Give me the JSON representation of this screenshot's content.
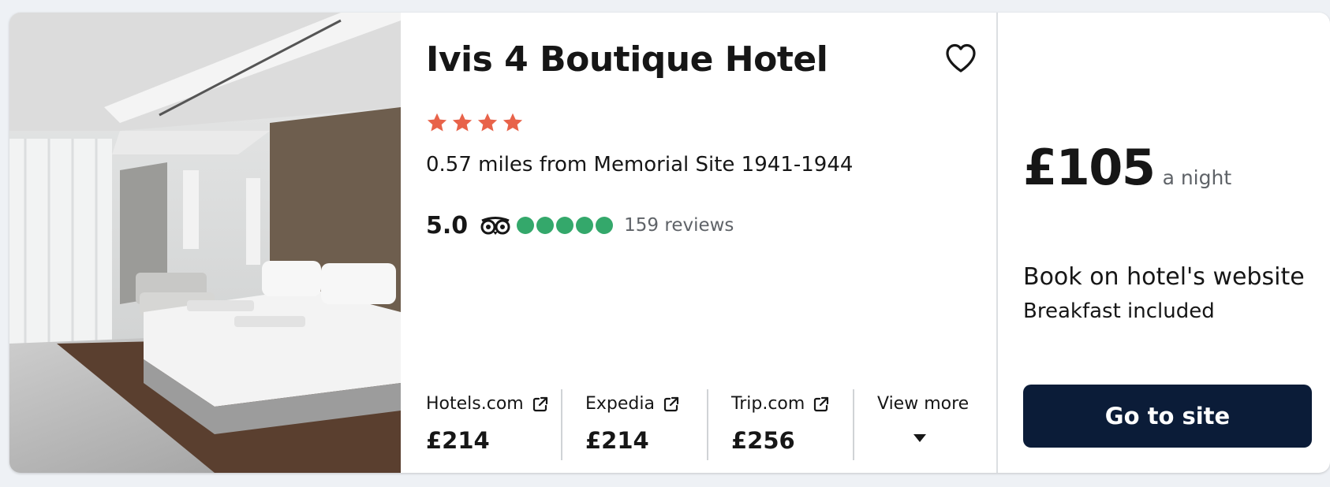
{
  "hotel": {
    "name": "Ivis 4 Boutique Hotel",
    "star_rating": 4,
    "star_color": "#e8634a",
    "distance_text": "0.57 miles from Memorial Site 1941-1944",
    "rating": {
      "score": "5.0",
      "icon": "tripadvisor-owl-icon",
      "bubbles_filled": 5,
      "bubble_color": "#34a86b",
      "reviews_text": "159 reviews"
    },
    "photo": {
      "alt": "Hotel room with large white bed"
    }
  },
  "providers": [
    {
      "name": "Hotels.com",
      "price": "£214",
      "icon": "external-link-icon"
    },
    {
      "name": "Expedia",
      "price": "£214",
      "icon": "external-link-icon"
    },
    {
      "name": "Trip.com",
      "price": "£256",
      "icon": "external-link-icon"
    }
  ],
  "view_more": {
    "label": "View more",
    "icon": "caret-down-icon"
  },
  "offer": {
    "price": "£105",
    "unit": "a night",
    "booking_text": "Book on hotel's website",
    "extras": "Breakfast included",
    "cta_label": "Go to site",
    "cta_color": "#0b1c38"
  },
  "favorite": {
    "icon": "heart-icon"
  }
}
